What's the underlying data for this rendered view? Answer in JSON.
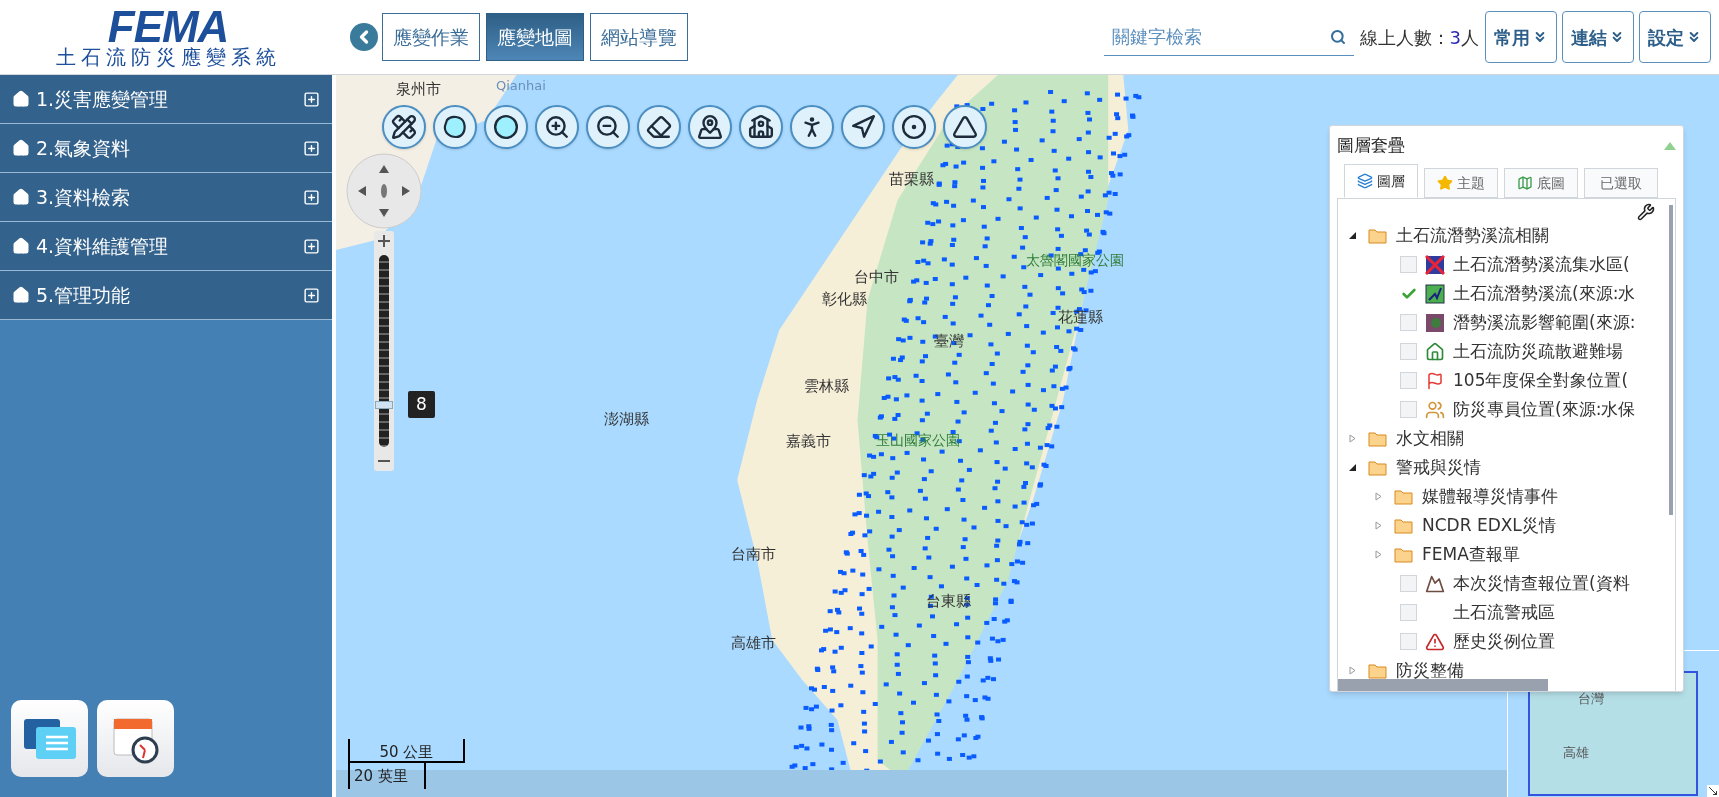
{
  "header": {
    "logo": "FEMA",
    "system_name": "土石流防災應變系統"
  },
  "nav_tabs": [
    {
      "label": "應變作業",
      "selected": false
    },
    {
      "label": "應變地圖",
      "selected": true
    },
    {
      "label": "網站導覽",
      "selected": false
    }
  ],
  "search": {
    "placeholder": "關鍵字檢索"
  },
  "online": {
    "label": "線上人數：",
    "count": "3",
    "unit": "人"
  },
  "menu_buttons": [
    "常用",
    "連結",
    "設定"
  ],
  "sidebar": {
    "items": [
      {
        "label": "1.災害應變管理",
        "expanded": false
      },
      {
        "label": "2.氣象資料",
        "expanded": false
      },
      {
        "label": "3.資料檢索",
        "expanded": false
      },
      {
        "label": "4.資料維護管理",
        "expanded": false
      },
      {
        "label": "5.管理功能",
        "expanded": false
      }
    ]
  },
  "map": {
    "labels": [
      "泉州市",
      "Qianhai",
      "苗栗縣",
      "台中市",
      "彰化縣",
      "太魯閣國家公園",
      "花蓮縣",
      "臺灣",
      "雲林縣",
      "澎湖縣",
      "嘉義市",
      "玉山國家公園",
      "台南市",
      "台東縣",
      "高雄市"
    ],
    "zoom": {
      "level": 0.22,
      "value": "8"
    },
    "scale": {
      "metric": "50 公里",
      "imperial": "20 英里"
    },
    "minimap_labels": [
      "台灣",
      "高雄"
    ]
  },
  "layer_panel": {
    "title": "圖層套疊",
    "tabs": [
      {
        "label": "圖層",
        "selected": true
      },
      {
        "label": "主題",
        "selected": false
      },
      {
        "label": "底圖",
        "selected": false
      },
      {
        "label": "已選取",
        "selected": false
      }
    ],
    "tree": [
      {
        "kind": "folder",
        "label": "土石流潛勢溪流相關",
        "expanded": true,
        "children": [
          {
            "kind": "layer",
            "label": "土石流潛勢溪流集水區(",
            "checked": false
          },
          {
            "kind": "layer",
            "label": "土石流潛勢溪流(來源:水",
            "checked": true
          },
          {
            "kind": "layer",
            "label": "潛勢溪流影響範圍(來源:",
            "checked": false
          },
          {
            "kind": "layer",
            "label": "土石流防災疏散避難場",
            "checked": false
          },
          {
            "kind": "layer",
            "label": "105年度保全對象位置(",
            "checked": false
          },
          {
            "kind": "layer",
            "label": "防災專員位置(來源:水保",
            "checked": false
          }
        ]
      },
      {
        "kind": "folder",
        "label": "水文相關",
        "expanded": false
      },
      {
        "kind": "folder",
        "label": "警戒與災情",
        "expanded": true,
        "children": [
          {
            "kind": "folder",
            "label": "媒體報導災情事件",
            "expanded": false
          },
          {
            "kind": "folder",
            "label": "NCDR EDXL災情",
            "expanded": false
          },
          {
            "kind": "folder",
            "label": "FEMA查報單",
            "expanded": false
          },
          {
            "kind": "layer",
            "label": "本次災情查報位置(資料",
            "checked": false
          },
          {
            "kind": "layer",
            "label": "土石流警戒區",
            "checked": false
          },
          {
            "kind": "layer",
            "label": "歷史災例位置",
            "checked": false
          }
        ]
      },
      {
        "kind": "folder",
        "label": "防災整備",
        "expanded": false
      }
    ]
  }
}
